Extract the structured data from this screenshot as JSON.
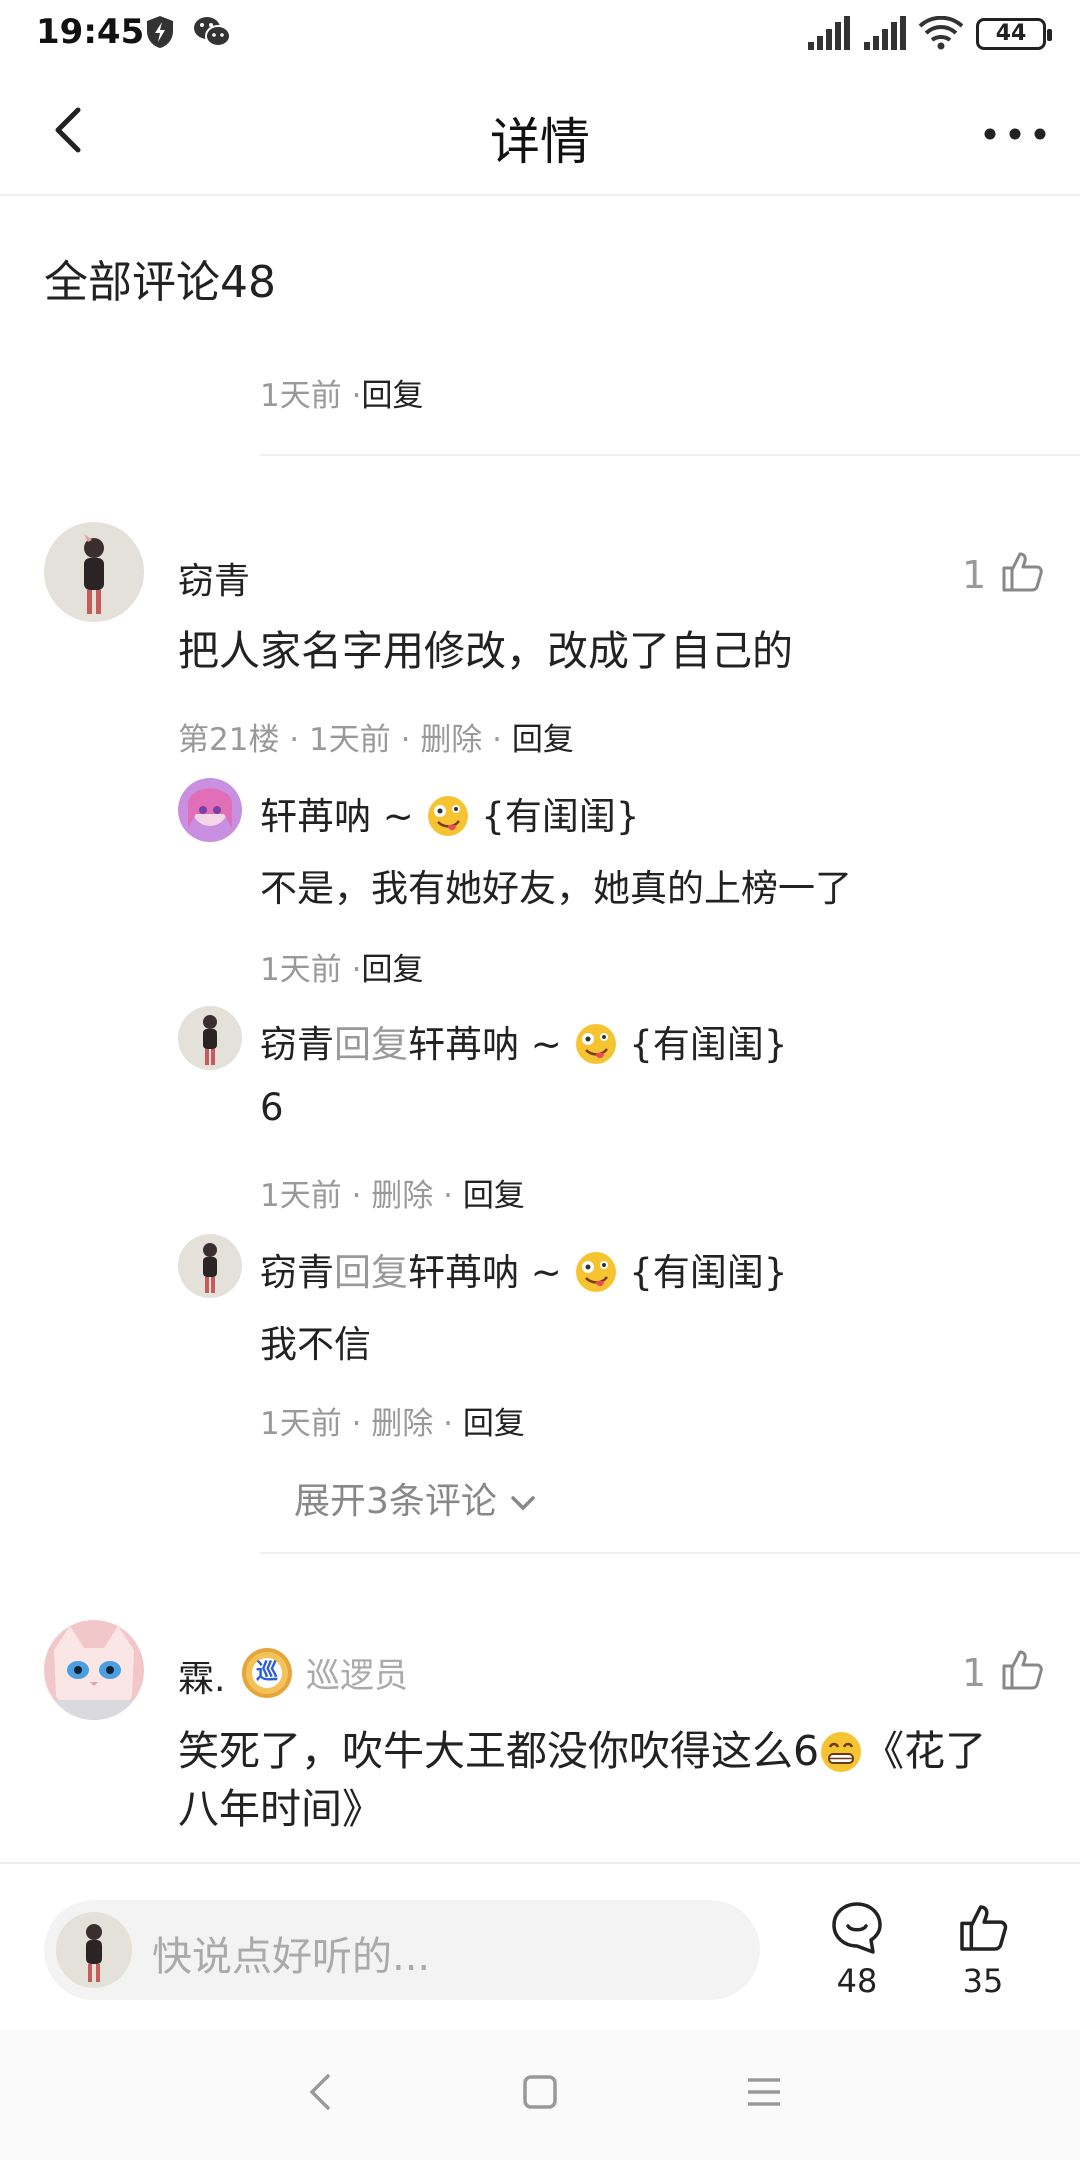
{
  "status": {
    "time": "19:45",
    "battery": "44"
  },
  "header": {
    "title": "详情"
  },
  "comments_section": {
    "title": "全部评论48"
  },
  "prev_comment": {
    "time": "1天前",
    "reply": "回复"
  },
  "comment1": {
    "username": "窃青",
    "text": "把人家名字用修改，改成了自己的",
    "floor": "第21楼",
    "time": "1天前",
    "delete": "删除",
    "reply": "回复",
    "likes": "1",
    "replies": [
      {
        "user": "轩苒呐 ~",
        "suffix": "{有闺闺}",
        "text": "不是，我有她好友，她真的上榜一了",
        "time": "1天前",
        "reply": "回复"
      },
      {
        "user": "窃青",
        "reply_word": "回复",
        "target": "轩苒呐 ~",
        "suffix": "{有闺闺}",
        "text": "6",
        "time": "1天前",
        "delete": "删除",
        "reply": "回复"
      },
      {
        "user": "窃青",
        "reply_word": "回复",
        "target": "轩苒呐 ~",
        "suffix": "{有闺闺}",
        "text": "我不信",
        "time": "1天前",
        "delete": "删除",
        "reply": "回复"
      }
    ],
    "expand": "展开3条评论"
  },
  "comment2": {
    "username": "霖.",
    "badge_char": "巡",
    "badge_label": "巡逻员",
    "text_line1": "笑死了，吹牛大王都没你吹得这么6",
    "text_line1_tail": "《花了",
    "text_line2": "八年时间》",
    "likes": "1"
  },
  "input_bar": {
    "placeholder": "快说点好听的...",
    "comment_count": "48",
    "like_count": "35"
  },
  "icons": {
    "back": "back-arrow-icon",
    "more": "more-dots-icon",
    "like": "thumbs-up-icon",
    "comment": "comment-bubble-icon",
    "emoji_tongue": "zany-face-emoji",
    "emoji_grin": "grin-emoji"
  },
  "colors": {
    "accent_reply": "#999999",
    "text": "#222222",
    "muted": "#999999",
    "badge": "#f4c25a"
  }
}
